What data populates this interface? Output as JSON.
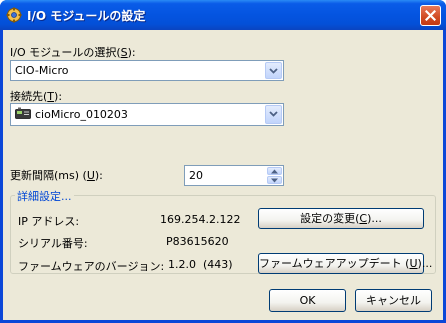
{
  "window": {
    "title": "I/O モジュールの設定",
    "close_label": "×"
  },
  "module_select": {
    "label": "I/O モジュールの選択",
    "mnemonic": "S",
    "value": "CIO-Micro"
  },
  "connection": {
    "label": "接続先",
    "mnemonic": "T",
    "value": "cioMicro_010203"
  },
  "update_interval": {
    "label": "更新間隔(ms) ",
    "mnemonic": "U",
    "value": "20"
  },
  "details": {
    "title": "詳細設定...",
    "ip_label": "IP アドレス:",
    "ip_value": "169.254.2.122",
    "change_button": "設定の変更",
    "change_mnemonic": "C",
    "serial_label": "シリアル番号:",
    "serial_value": "P83615620",
    "firmware_label": "ファームウェアのバージョン:",
    "firmware_value": "1.2.0  (443)",
    "update_button": "ファームウェアアップデート",
    "update_mnemonic": "U"
  },
  "footer": {
    "ok": "OK",
    "cancel": "キャンセル"
  },
  "colors": {
    "title_bar": "#0454e0",
    "dialog_bg": "#ece9d8",
    "group_title": "#0046d5"
  }
}
